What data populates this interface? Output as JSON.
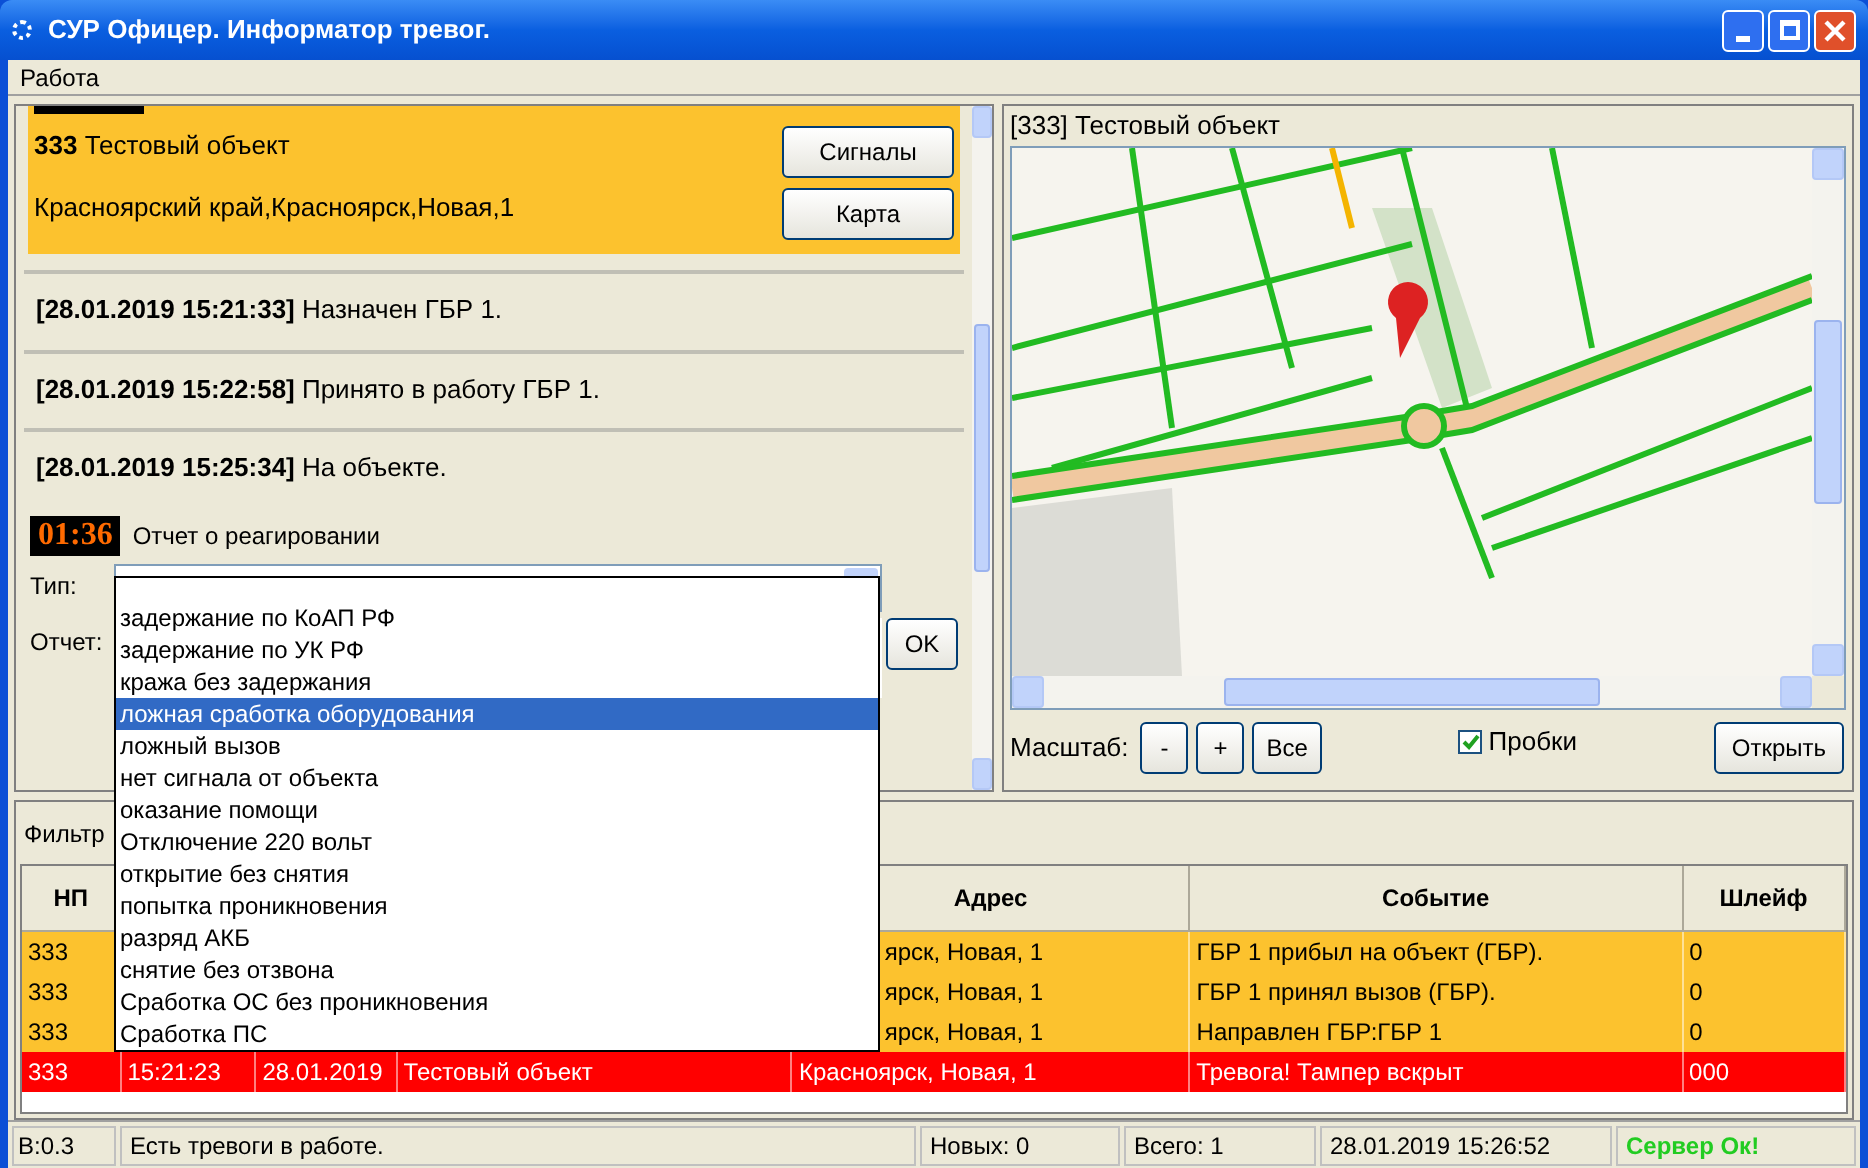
{
  "window": {
    "title": "СУР Офицер. Информатор тревог."
  },
  "menu": [
    "Работа"
  ],
  "alarm_card": {
    "title": "**333** Тестовый объект",
    "address": "Красноярский край,Красноярск,Новая,1",
    "buttons": [
      "Сигналы",
      "Карта"
    ]
  },
  "log": [
    "**[28.01.2019 15:21:33]** Назначен ГБР 1.",
    "**[28.01.2019 15:22:58]** Принято в работу ГБР 1.",
    "**[28.01.2019 15:25:34]** На объекте."
  ],
  "report": {
    "timer": "01:36",
    "title": "Отчет о реагировании",
    "type_label": "Тип:",
    "report_label": "Отчет:",
    "ok": "OK",
    "dropdown": {
      "expanded": true,
      "options": [
        {
          "label": "задержание по КоАП РФ",
          "selected": false
        },
        {
          "label": "задержание по УК РФ",
          "selected": false
        },
        {
          "label": "кража без задержания",
          "selected": false
        },
        {
          "label": "ложная сработка оборудования",
          "selected": true
        },
        {
          "label": "ложный вызов",
          "selected": false
        },
        {
          "label": "нет сигнала от объекта",
          "selected": false
        },
        {
          "label": "оказание помощи",
          "selected": false
        },
        {
          "label": "Отключение 220 вольт",
          "selected": false
        },
        {
          "label": "открытие без снятия",
          "selected": false
        },
        {
          "label": "попытка проникновения",
          "selected": false
        },
        {
          "label": "разряд АКБ",
          "selected": false
        },
        {
          "label": "снятие без отзвона",
          "selected": false
        },
        {
          "label": "Сработка ОС без проникновения",
          "selected": false
        },
        {
          "label": "Сработка ПС",
          "selected": false
        }
      ]
    }
  },
  "map_panel": {
    "title": "[333] Тестовый объект",
    "scale_label": "Масштаб:",
    "zoom_buttons": [
      "-",
      "+",
      "Все"
    ],
    "traffic": {
      "label": "Пробки",
      "checked": true
    },
    "open_button": "Открыть"
  },
  "filter_label": "Фильтр",
  "table": {
    "columns": [
      "НП",
      null,
      null,
      null,
      "Адрес",
      "Событие",
      "Шлейф"
    ],
    "rows": [
      {
        "color": "#fcc22e",
        "covered": true,
        "cells": [
          "333",
          null,
          null,
          null,
          "ярск, Новая, 1",
          "ГБР 1 прибыл на объект (ГБР).",
          "0"
        ]
      },
      {
        "color": "#fcc22e",
        "covered": true,
        "cells": [
          "333",
          null,
          null,
          null,
          "ярск, Новая, 1",
          "ГБР 1 принял вызов (ГБР).",
          "0"
        ]
      },
      {
        "color": "#fcc22e",
        "covered": true,
        "cells": [
          "333",
          null,
          null,
          null,
          "ярск, Новая, 1",
          "Направлен ГБР:ГБР 1",
          "0"
        ]
      },
      {
        "color": "#ff0000",
        "covered": false,
        "cells": [
          "333",
          "15:21:23",
          "28.01.2019",
          "Тестовый объект",
          "Красноярск, Новая, 1",
          "Тревога! Тампер вскрыт",
          "000"
        ]
      }
    ]
  },
  "status_bar": {
    "version": "B:0.3",
    "message": "Есть тревоги в работе.",
    "new": "Новых: 0",
    "total": "Всего: 1",
    "datetime": "28.01.2019 15:26:52",
    "server": {
      "text": "Сервер Ок!",
      "ok": true
    }
  }
}
